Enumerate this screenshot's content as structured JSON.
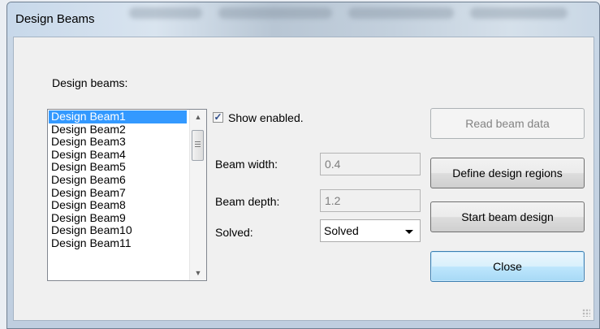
{
  "window": {
    "title": "Design Beams"
  },
  "main": {
    "list_label": "Design beams:",
    "beams": [
      "Design Beam1",
      "Design Beam2",
      "Design Beam3",
      "Design Beam4",
      "Design Beam5",
      "Design Beam6",
      "Design Beam7",
      "Design Beam8",
      "Design Beam9",
      "Design Beam10",
      "Design Beam11"
    ],
    "selected_beam": "Design Beam1",
    "show_enabled": {
      "label": "Show enabled.",
      "checked": true
    },
    "beam_width": {
      "label": "Beam width:",
      "value": "0.4"
    },
    "beam_depth": {
      "label": "Beam depth:",
      "value": "1.2"
    },
    "solved": {
      "label": "Solved:",
      "value": "Solved"
    }
  },
  "buttons": {
    "read_beam_data": "Read beam data",
    "define_design_regions": "Define design regions",
    "start_beam_design": "Start beam design",
    "close": "Close"
  },
  "icons": {
    "scroll_up": "chevron-up-icon",
    "scroll_down": "chevron-down-icon",
    "combo_dropdown": "chevron-down-icon",
    "checkbox_check": "check-icon"
  },
  "colors": {
    "selection": "#3399ff",
    "default_button_border": "#3c7fb1",
    "dialog_bg": "#f0f0f0"
  }
}
